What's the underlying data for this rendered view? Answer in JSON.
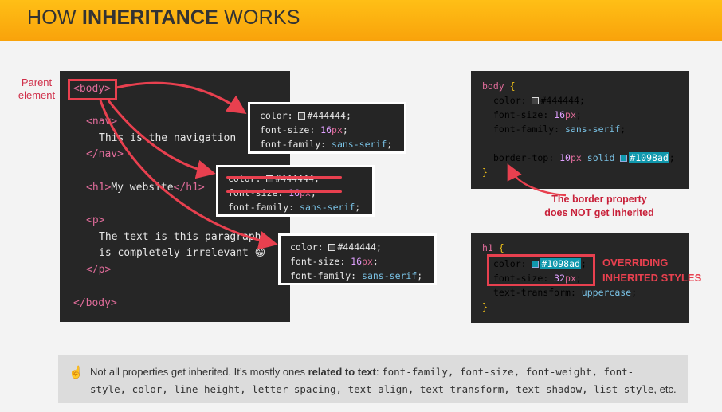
{
  "header": {
    "title_pre": "HOW ",
    "title_bold": "INHERITANCE",
    "title_post": " WORKS"
  },
  "annotations": {
    "parent_line1": "Parent",
    "parent_line2": "element",
    "border_note_1": "The border property",
    "border_note_2a": "does ",
    "border_note_2b": "NOT",
    "border_note_2c": " get inherited",
    "override_1": "OVERRIDING",
    "override_2": "INHERITED STYLES"
  },
  "html_code": {
    "body_open": "<body>",
    "nav_open": "<nav>",
    "nav_text": "This is the navigation",
    "nav_close": "</nav>",
    "h1_open": "<h1>",
    "h1_text": "My website",
    "h1_close": "</h1>",
    "p_open": "<p>",
    "p_text1": "The text is this paragraph",
    "p_text2": "is completely irrelevant",
    "emoji": "😁",
    "p_close": "</p>",
    "body_close": "</body>"
  },
  "popups": {
    "color_prop": "color",
    "color_val": "#444444",
    "size_prop": "font-size",
    "size_num": "16",
    "size_unit": "px",
    "family_prop": "font-family",
    "family_val": "sans-serif"
  },
  "css_body": {
    "selector": "body",
    "color_val": "#444444",
    "size_num": "16",
    "family_val": "sans-serif",
    "border_prop": "border-top",
    "border_num": "10",
    "border_unit": "px",
    "border_style": "solid",
    "border_color": "#1098ad"
  },
  "css_h1": {
    "selector": "h1",
    "color_val": "#1098ad",
    "size_num": "32",
    "tt_prop": "text-transform",
    "tt_val": "uppercase"
  },
  "tip": {
    "icon": "☝",
    "text_pre": "Not all properties get inherited. It’s mostly ones ",
    "text_bold": "related to text",
    "text_colon": ": ",
    "list_line1": "font-family, font-size, font-weight, font-",
    "list_line2": "style, color, line-height, letter-spacing, text-align, text-transform, text-shadow, list-style",
    "etc": ", etc."
  },
  "colors": {
    "accent": "#f9a20a",
    "red": "#e8404f",
    "teal": "#1098ad",
    "panel": "#262626"
  }
}
